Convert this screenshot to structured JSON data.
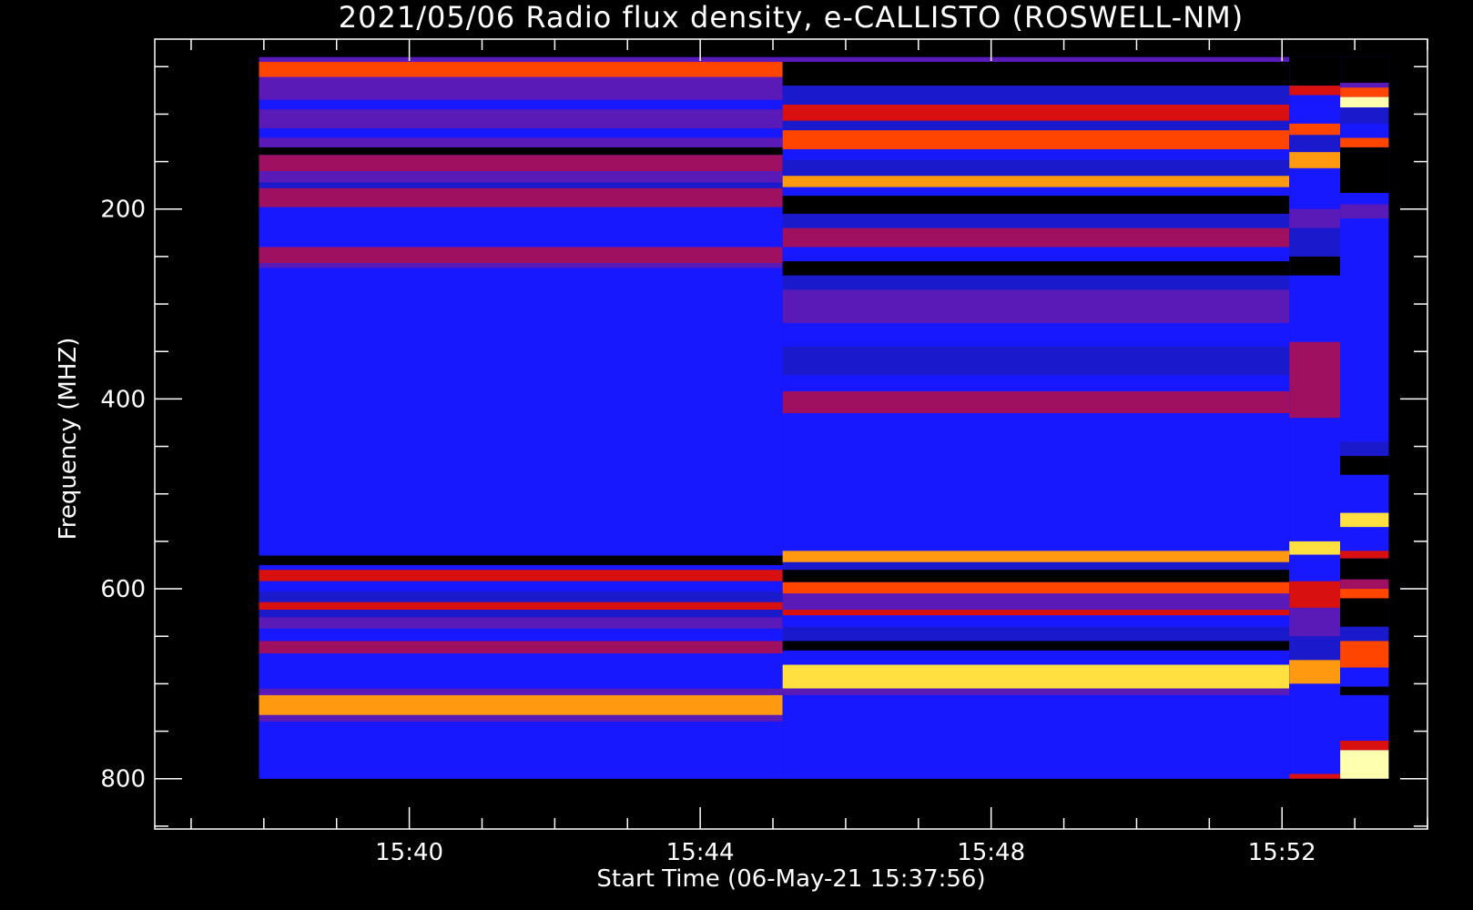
{
  "chart_data": {
    "type": "heatmap",
    "title": "2021/05/06  Radio flux density, e-CALLISTO (ROSWELL-NM)",
    "xlabel": "Start Time (06-May-21 15:37:56)",
    "ylabel": "Frequency (MHZ)",
    "x_unit": "minutes",
    "xlim": [
      "15:36:30",
      "15:54:00"
    ],
    "ylim": [
      21,
      853
    ],
    "y_inverted": true,
    "x_ticks": [
      {
        "time": "15:40",
        "label": "15:40"
      },
      {
        "time": "15:44",
        "label": "15:44"
      },
      {
        "time": "15:48",
        "label": "15:48"
      },
      {
        "time": "15:52",
        "label": "15:52"
      }
    ],
    "y_ticks": [
      {
        "value": 200,
        "label": "200"
      },
      {
        "value": 400,
        "label": "400"
      },
      {
        "value": 600,
        "label": "600"
      },
      {
        "value": 800,
        "label": "800"
      }
    ],
    "colormap": [
      "#000000",
      "#1a1acc",
      "#1818ff",
      "#5a1ab8",
      "#a01060",
      "#d81010",
      "#ff4500",
      "#ff9a10",
      "#ffe040",
      "#ffffb0"
    ],
    "segments": [
      {
        "time_start": "15:37:56",
        "time_end": "15:45:08",
        "base": 2,
        "bands": [
          [
            40,
            45,
            3
          ],
          [
            45,
            61,
            6
          ],
          [
            61,
            85,
            3
          ],
          [
            85,
            95,
            2
          ],
          [
            95,
            115,
            3
          ],
          [
            115,
            125,
            2
          ],
          [
            125,
            135,
            3
          ],
          [
            135,
            143,
            0
          ],
          [
            143,
            160,
            4
          ],
          [
            160,
            172,
            3
          ],
          [
            172,
            178,
            1
          ],
          [
            178,
            198,
            4
          ],
          [
            198,
            240,
            2
          ],
          [
            240,
            257,
            4
          ],
          [
            257,
            262,
            3
          ],
          [
            262,
            565,
            2
          ],
          [
            565,
            575,
            0
          ],
          [
            575,
            580,
            2
          ],
          [
            580,
            592,
            5
          ],
          [
            592,
            603,
            2
          ],
          [
            603,
            614,
            1
          ],
          [
            614,
            622,
            5
          ],
          [
            622,
            630,
            1
          ],
          [
            630,
            642,
            3
          ],
          [
            642,
            655,
            2
          ],
          [
            655,
            668,
            4
          ],
          [
            668,
            705,
            2
          ],
          [
            705,
            712,
            3
          ],
          [
            712,
            733,
            7
          ],
          [
            733,
            740,
            3
          ],
          [
            740,
            800,
            2
          ]
        ]
      },
      {
        "time_start": "15:45:08",
        "time_end": "15:52:06",
        "base": 2,
        "bands": [
          [
            40,
            45,
            3
          ],
          [
            45,
            70,
            0
          ],
          [
            70,
            90,
            1
          ],
          [
            90,
            107,
            5
          ],
          [
            107,
            117,
            1
          ],
          [
            117,
            137,
            6
          ],
          [
            137,
            148,
            2
          ],
          [
            148,
            165,
            1
          ],
          [
            165,
            177,
            7
          ],
          [
            177,
            186,
            2
          ],
          [
            186,
            205,
            0
          ],
          [
            205,
            220,
            1
          ],
          [
            220,
            240,
            4
          ],
          [
            240,
            255,
            2
          ],
          [
            255,
            270,
            0
          ],
          [
            270,
            285,
            1
          ],
          [
            285,
            320,
            3
          ],
          [
            320,
            345,
            2
          ],
          [
            345,
            375,
            1
          ],
          [
            375,
            392,
            2
          ],
          [
            392,
            415,
            4
          ],
          [
            415,
            560,
            2
          ],
          [
            560,
            572,
            7
          ],
          [
            572,
            580,
            1
          ],
          [
            580,
            593,
            0
          ],
          [
            593,
            605,
            6
          ],
          [
            605,
            622,
            3
          ],
          [
            622,
            628,
            5
          ],
          [
            628,
            640,
            2
          ],
          [
            640,
            655,
            1
          ],
          [
            655,
            665,
            0
          ],
          [
            665,
            680,
            2
          ],
          [
            680,
            705,
            8
          ],
          [
            705,
            712,
            3
          ],
          [
            712,
            800,
            2
          ]
        ]
      },
      {
        "time_start": "15:52:06",
        "time_end": "15:52:48",
        "base": 2,
        "bands": [
          [
            40,
            70,
            0
          ],
          [
            70,
            80,
            5
          ],
          [
            80,
            110,
            2
          ],
          [
            110,
            122,
            6
          ],
          [
            122,
            140,
            1
          ],
          [
            140,
            157,
            7
          ],
          [
            157,
            200,
            2
          ],
          [
            200,
            220,
            3
          ],
          [
            220,
            250,
            1
          ],
          [
            250,
            270,
            0
          ],
          [
            270,
            340,
            2
          ],
          [
            340,
            420,
            4
          ],
          [
            420,
            550,
            2
          ],
          [
            550,
            564,
            8
          ],
          [
            564,
            592,
            2
          ],
          [
            592,
            620,
            5
          ],
          [
            620,
            650,
            3
          ],
          [
            650,
            675,
            1
          ],
          [
            675,
            700,
            7
          ],
          [
            700,
            795,
            2
          ],
          [
            795,
            800,
            5
          ]
        ]
      },
      {
        "time_start": "15:52:48",
        "time_end": "15:53:28",
        "base": 2,
        "bands": [
          [
            40,
            67,
            0
          ],
          [
            67,
            72,
            3
          ],
          [
            72,
            82,
            6
          ],
          [
            82,
            93,
            9
          ],
          [
            93,
            110,
            1
          ],
          [
            110,
            125,
            2
          ],
          [
            125,
            135,
            6
          ],
          [
            135,
            183,
            0
          ],
          [
            183,
            195,
            2
          ],
          [
            195,
            210,
            3
          ],
          [
            210,
            445,
            2
          ],
          [
            445,
            460,
            1
          ],
          [
            460,
            480,
            0
          ],
          [
            480,
            520,
            2
          ],
          [
            520,
            535,
            8
          ],
          [
            535,
            560,
            2
          ],
          [
            560,
            568,
            5
          ],
          [
            568,
            590,
            0
          ],
          [
            590,
            600,
            4
          ],
          [
            600,
            610,
            6
          ],
          [
            610,
            640,
            0
          ],
          [
            640,
            655,
            1
          ],
          [
            655,
            683,
            6
          ],
          [
            683,
            703,
            2
          ],
          [
            703,
            712,
            0
          ],
          [
            712,
            760,
            2
          ],
          [
            760,
            770,
            5
          ],
          [
            770,
            800,
            9
          ]
        ]
      }
    ]
  }
}
